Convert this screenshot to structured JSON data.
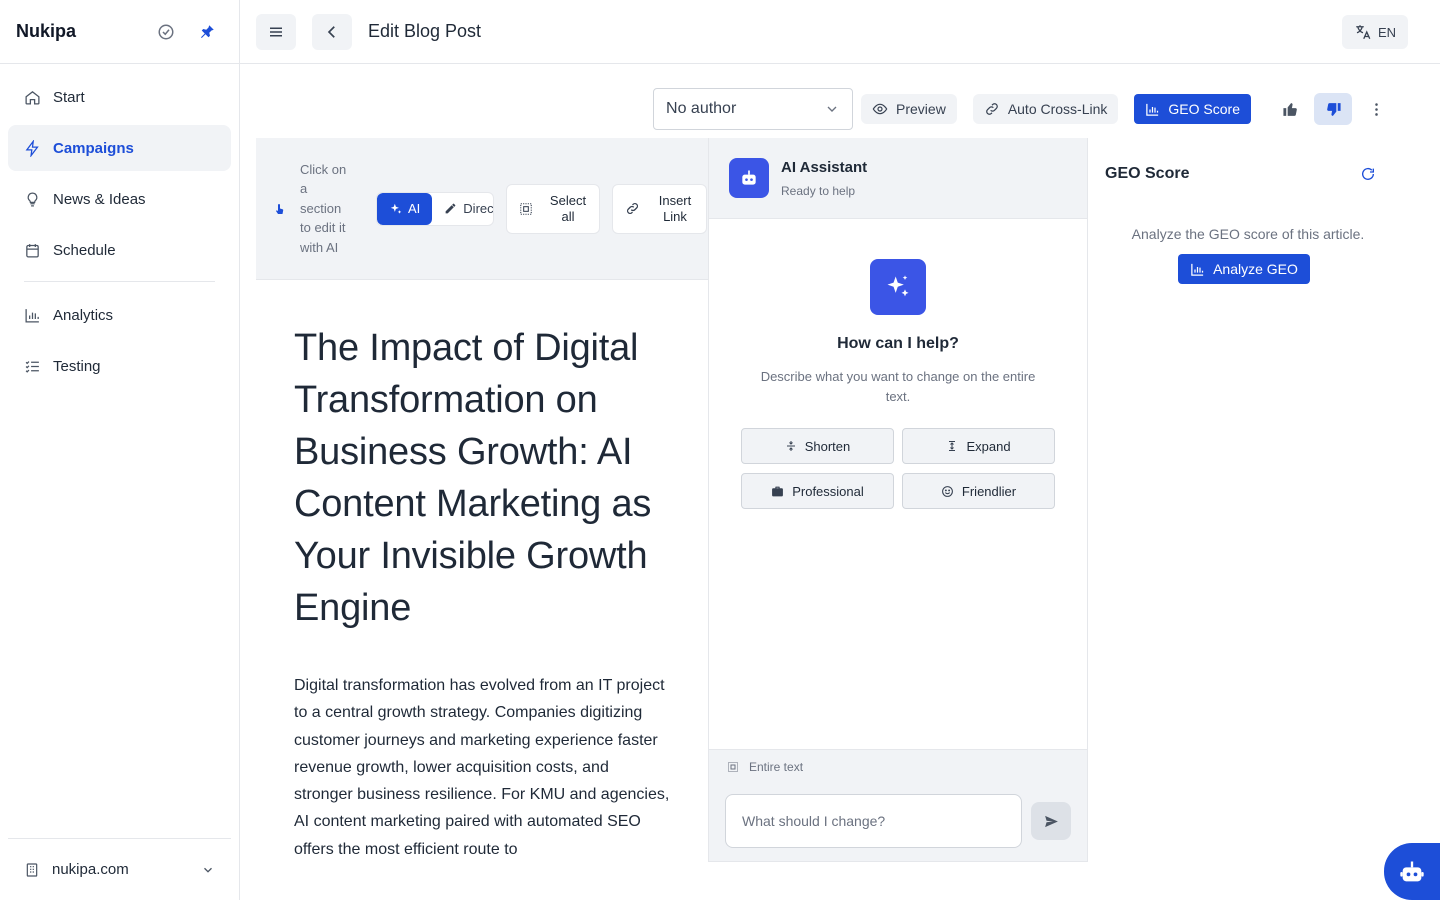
{
  "sidebar": {
    "brand": "Nukipa",
    "items": [
      {
        "label": "Start",
        "icon": "home-icon"
      },
      {
        "label": "Campaigns",
        "icon": "bolt-icon",
        "active": true
      },
      {
        "label": "News & Ideas",
        "icon": "lightbulb-icon"
      },
      {
        "label": "Schedule",
        "icon": "calendar-icon"
      },
      {
        "label": "Analytics",
        "icon": "bar-chart-icon"
      },
      {
        "label": "Testing",
        "icon": "checklist-icon"
      }
    ],
    "workspace": "nukipa.com"
  },
  "topbar": {
    "title": "Edit Blog Post",
    "language": "EN"
  },
  "actions": {
    "author": "No author",
    "preview": "Preview",
    "cross_link": "Auto Cross-Link",
    "geo_score": "GEO Score"
  },
  "editor": {
    "hint": "Click on a section to edit it with AI",
    "mode_ai": "AI",
    "mode_direct": "Direct",
    "select_all": "Select all",
    "insert_link": "Insert Link",
    "headline": "The Impact of Digital Transformation on Business Growth: AI Content Marketing as Your Invisible Growth Engine",
    "body": "Digital transformation has evolved from an IT project to a central growth strategy. Companies digitizing customer journeys and marketing experience faster revenue growth, lower acquisition costs, and stronger business resilience. For KMU and agencies, AI content marketing paired with automated SEO offers the most efficient route to"
  },
  "assistant": {
    "title": "AI Assistant",
    "status": "Ready to help",
    "heading": "How can I help?",
    "description": "Describe what you want to change on the entire text.",
    "quick_actions": [
      {
        "label": "Shorten",
        "icon": "compress-icon"
      },
      {
        "label": "Expand",
        "icon": "expand-icon"
      },
      {
        "label": "Professional",
        "icon": "briefcase-icon"
      },
      {
        "label": "Friendlier",
        "icon": "smile-icon"
      }
    ],
    "scope": "Entire text",
    "input_placeholder": "What should I change?"
  },
  "geo": {
    "title": "GEO Score",
    "description": "Analyze the GEO score of this article.",
    "button": "Analyze GEO"
  },
  "colors": {
    "accent": "#1d4ed8",
    "assistant": "#3b55e6",
    "panel_bg": "#f1f3f6"
  }
}
